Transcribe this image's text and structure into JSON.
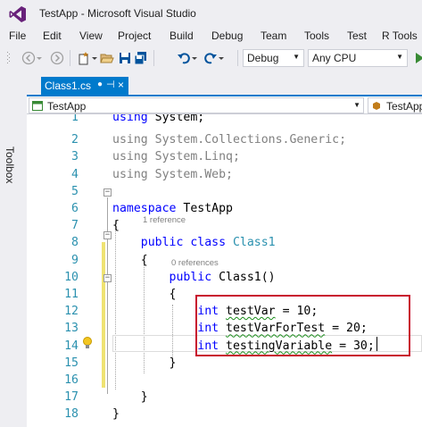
{
  "window": {
    "title": "TestApp - Microsoft Visual Studio"
  },
  "menu": [
    "File",
    "Edit",
    "View",
    "Project",
    "Build",
    "Debug",
    "Team",
    "Tools",
    "Test",
    "R Tools"
  ],
  "toolbar": {
    "configuration": "Debug",
    "platform": "Any CPU"
  },
  "side_panel": {
    "toolbox_label": "Toolbox"
  },
  "tab": {
    "label": "Class1.cs",
    "modified_marker": "●",
    "pin": "⊣",
    "close": "×"
  },
  "nav": {
    "project": "TestApp",
    "type": "TestApp"
  },
  "editor": {
    "lines": [
      {
        "num": "1",
        "segments": [
          {
            "t": "using ",
            "c": "kw"
          },
          {
            "t": "System;",
            "c": ""
          }
        ]
      },
      {
        "num": "2",
        "segments": [
          {
            "t": "using ",
            "c": "gray"
          },
          {
            "t": "System.Collections.Generic;",
            "c": "gray"
          }
        ]
      },
      {
        "num": "3",
        "segments": [
          {
            "t": "using ",
            "c": "gray"
          },
          {
            "t": "System.Linq;",
            "c": "gray"
          }
        ]
      },
      {
        "num": "4",
        "segments": [
          {
            "t": "using ",
            "c": "gray"
          },
          {
            "t": "System.Web;",
            "c": "gray"
          }
        ]
      },
      {
        "num": "5",
        "segments": []
      },
      {
        "num": "6",
        "segments": [
          {
            "t": "namespace ",
            "c": "kw"
          },
          {
            "t": "TestApp",
            "c": ""
          }
        ]
      },
      {
        "num": "7",
        "segments": [
          {
            "t": "{",
            "c": ""
          }
        ]
      },
      {
        "num": "8",
        "segments": [
          {
            "t": "    public ",
            "c": "kw"
          },
          {
            "t": "class ",
            "c": "kw"
          },
          {
            "t": "Class1",
            "c": "ty"
          }
        ]
      },
      {
        "num": "9",
        "segments": [
          {
            "t": "    {",
            "c": ""
          }
        ]
      },
      {
        "num": "10",
        "segments": [
          {
            "t": "        public ",
            "c": "kw"
          },
          {
            "t": "Class1()",
            "c": ""
          }
        ]
      },
      {
        "num": "11",
        "segments": [
          {
            "t": "        {",
            "c": ""
          }
        ]
      },
      {
        "num": "12",
        "segments": [
          {
            "t": "            int ",
            "c": "kw"
          },
          {
            "t": "testVar",
            "c": "squig"
          },
          {
            "t": " = 10;",
            "c": ""
          }
        ]
      },
      {
        "num": "13",
        "segments": [
          {
            "t": "            int ",
            "c": "kw"
          },
          {
            "t": "testVarForTest",
            "c": "squig"
          },
          {
            "t": " = 20;",
            "c": ""
          }
        ]
      },
      {
        "num": "14",
        "segments": [
          {
            "t": "            int ",
            "c": "kw"
          },
          {
            "t": "testingVariable",
            "c": "squig"
          },
          {
            "t": " = 30;",
            "c": ""
          }
        ]
      },
      {
        "num": "15",
        "segments": [
          {
            "t": "        }",
            "c": ""
          }
        ]
      },
      {
        "num": "16",
        "segments": []
      },
      {
        "num": "17",
        "segments": [
          {
            "t": "    }",
            "c": ""
          }
        ]
      },
      {
        "num": "18",
        "segments": [
          {
            "t": "}",
            "c": ""
          }
        ]
      }
    ],
    "hints": {
      "class_refs": "1 reference",
      "ctor_refs": "0 references"
    }
  },
  "colors": {
    "accent": "#007acc",
    "highlight_border": "#c8102e",
    "change_bar": "#efe372"
  }
}
